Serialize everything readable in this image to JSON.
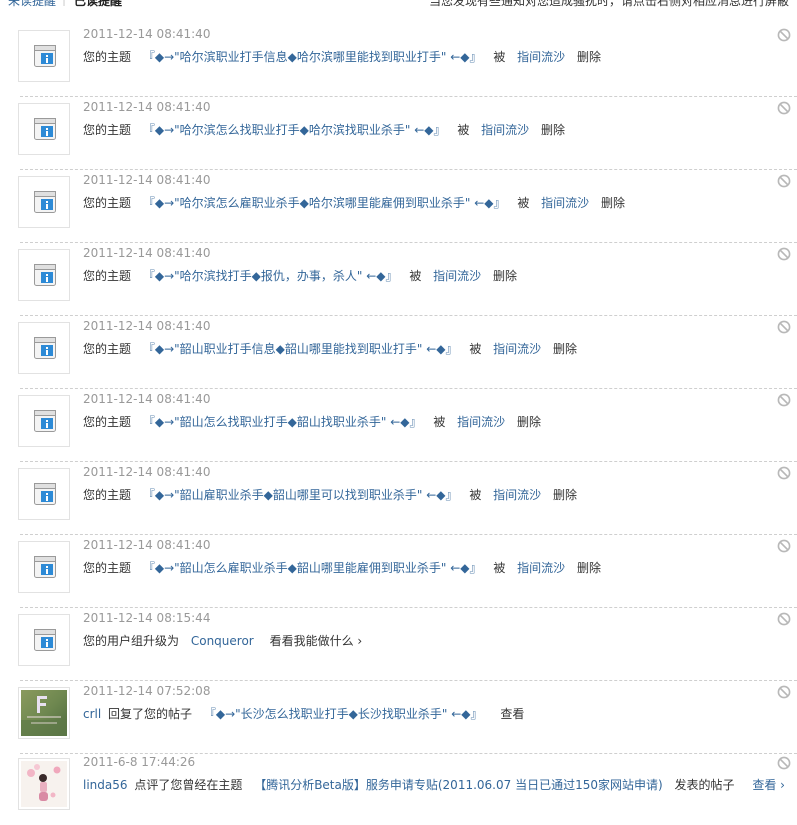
{
  "tabs": {
    "unread": "未读提醒",
    "separator": "|",
    "read": "已读提醒"
  },
  "top_hint": "当您发现有些通知对您造成骚扰时，请点击右侧对相应消息进行屏蔽",
  "labels": {
    "your_topic": "您的主题",
    "by": "被",
    "delete": "删除",
    "upgrade_prefix": "您的用户组升级为",
    "replied_to": "回复了您的帖子",
    "view": "查看",
    "commented": "点评了您曾经在主题",
    "posted": "发表的帖子"
  },
  "items": [
    {
      "time": "2011-12-14 08:41:40",
      "topic": "『◆→\"哈尔滨职业打手信息◆哈尔滨哪里能找到职业打手\" ←◆』",
      "actor": "指间流沙"
    },
    {
      "time": "2011-12-14 08:41:40",
      "topic": "『◆→\"哈尔滨怎么找职业打手◆哈尔滨找职业杀手\" ←◆』",
      "actor": "指间流沙"
    },
    {
      "time": "2011-12-14 08:41:40",
      "topic": "『◆→\"哈尔滨怎么雇职业杀手◆哈尔滨哪里能雇佣到职业杀手\" ←◆』",
      "actor": "指间流沙"
    },
    {
      "time": "2011-12-14 08:41:40",
      "topic": "『◆→\"哈尔滨找打手◆报仇，办事，杀人\" ←◆』",
      "actor": "指间流沙"
    },
    {
      "time": "2011-12-14 08:41:40",
      "topic": "『◆→\"韶山职业打手信息◆韶山哪里能找到职业打手\" ←◆』",
      "actor": "指间流沙"
    },
    {
      "time": "2011-12-14 08:41:40",
      "topic": "『◆→\"韶山怎么找职业打手◆韶山找职业杀手\" ←◆』",
      "actor": "指间流沙"
    },
    {
      "time": "2011-12-14 08:41:40",
      "topic": "『◆→\"韶山雇职业杀手◆韶山哪里可以找到职业杀手\" ←◆』",
      "actor": "指间流沙"
    },
    {
      "time": "2011-12-14 08:41:40",
      "topic": "『◆→\"韶山怎么雇职业杀手◆韶山哪里能雇佣到职业杀手\" ←◆』",
      "actor": "指间流沙"
    }
  ],
  "upgrade": {
    "time": "2011-12-14 08:15:44",
    "group": "Conqueror",
    "link": "看看我能做什么 ›"
  },
  "reply": {
    "time": "2011-12-14 07:52:08",
    "user": "crll",
    "topic": "『◆→\"长沙怎么找职业打手◆长沙找职业杀手\" ←◆』"
  },
  "comment": {
    "time": "2011-6-8 17:44:26",
    "user": "linda56",
    "topic": "【腾讯分析Beta版】服务申请专贴(2011.06.07 当日已通过150家网站申请)",
    "view_link": "查看 ›"
  }
}
